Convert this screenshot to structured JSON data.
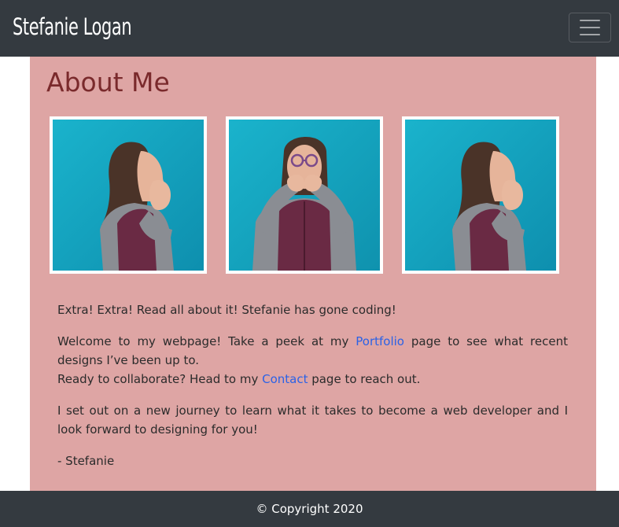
{
  "navbar": {
    "brand": "Stefanie Logan",
    "toggler_icon": "hamburger-menu-icon"
  },
  "main": {
    "title": "About Me",
    "photos": [
      {
        "pose": "profile facing left, hands to mouth"
      },
      {
        "pose": "facing forward with glasses, hands to mouth"
      },
      {
        "pose": "profile facing left, hands to mouth (mirrored)"
      }
    ],
    "intro": "Extra! Extra! Read all about it! Stefanie has gone coding!",
    "welcome_before": "Welcome to my webpage! Take a peek at my ",
    "portfolio_link": "Portfolio",
    "welcome_after": " page to see what recent designs I’ve been up to.",
    "collab_before": "Ready to collaborate? Head to my ",
    "contact_link": "Contact",
    "collab_after": " page to reach out.",
    "journey": "I set out on a new journey to learn what it takes to become a web developer and I look forward to designing for you!",
    "signature": "- Stefanie"
  },
  "footer": {
    "copyright": "© Copyright 2020"
  },
  "colors": {
    "navbar_bg": "#343a40",
    "main_bg": "#dea5a4",
    "title": "#7a2a2c",
    "link": "#2b62e6",
    "photo_bg": "#18aec8"
  }
}
